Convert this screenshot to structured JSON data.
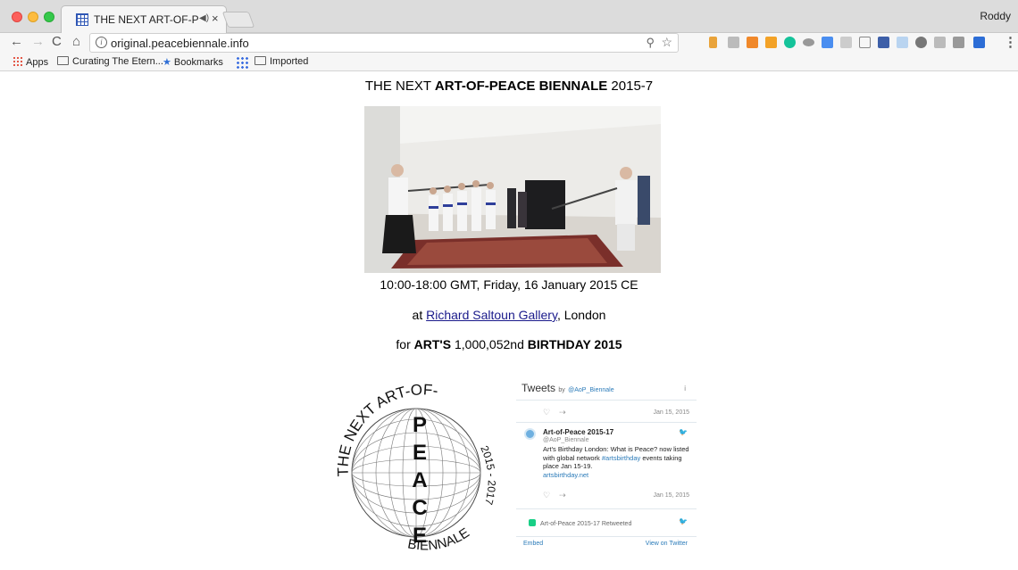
{
  "browser": {
    "tab_title": "THE NEXT ART-OF-PEACE",
    "user": "Roddy",
    "url": "original.peacebiennale.info",
    "bookmarks": [
      "Apps",
      "Curating The Etern...",
      "Bookmarks",
      "Imported"
    ]
  },
  "page": {
    "headline_pre": "THE NEXT ",
    "headline_bold": "ART-OF-PEACE BIENNALE",
    "headline_post": " 2015-7",
    "time": "10:00-18:00 GMT, Friday, 16 January 2015 CE",
    "venue_pre": "at ",
    "venue_link": "Richard Saltoun Gallery",
    "venue_post": ", London",
    "bday_pre": "for ",
    "bday_bold1": "ART'S",
    "bday_mid": " 1,000,052nd ",
    "bday_bold2": "BIRTHDAY 2015"
  },
  "logo": {
    "top_arc": "THE NEXT ART-OF-",
    "right_arc": "2015 - 2017",
    "bottom_arc": "BIENNALE",
    "letters": [
      "P",
      "E",
      "A",
      "C",
      "E"
    ]
  },
  "twitter": {
    "title": "Tweets",
    "by": "by",
    "handle_link": "@AoP_Biennale",
    "info": "i",
    "date1": "Jan 15, 2015",
    "name": "Art-of-Peace 2015-17",
    "handle": "@AoP_Biennale",
    "text": "Art's Birthday London: What is Peace? now listed with global network",
    "hashtag": "#artsbirthday",
    "text2": "events taking place Jan 15-19.",
    "link": "artsbirthday.net",
    "date2": "Jan 15, 2015",
    "retweeted": "Art-of-Peace 2015-17 Retweeted",
    "embed": "Embed",
    "view": "View on Twitter"
  }
}
